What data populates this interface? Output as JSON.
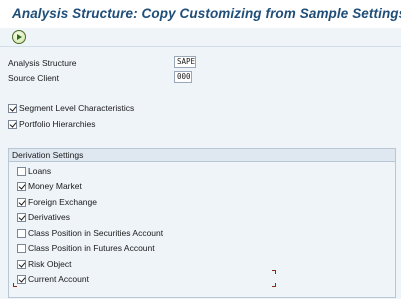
{
  "header": {
    "title": "Analysis Structure: Copy Customizing from Sample Settings"
  },
  "toolbar": {
    "execute_icon": "execute-icon"
  },
  "form": {
    "analysis_structure": {
      "label": "Analysis Structure",
      "value": "SAPE"
    },
    "source_client": {
      "label": "Source Client",
      "value": "000"
    },
    "options": [
      {
        "label": "Segment Level Characteristics",
        "checked": true
      },
      {
        "label": "Portfolio Hierarchies",
        "checked": true
      }
    ]
  },
  "derivation": {
    "title": "Derivation Settings",
    "items": [
      {
        "label": "Loans",
        "checked": false
      },
      {
        "label": "Money Market",
        "checked": true
      },
      {
        "label": "Foreign Exchange",
        "checked": true
      },
      {
        "label": "Derivatives",
        "checked": true
      },
      {
        "label": "Class Position in Securities Account",
        "checked": false
      },
      {
        "label": "Class Position in Futures Account",
        "checked": false
      },
      {
        "label": "Risk Object",
        "checked": true
      },
      {
        "label": "Current Account",
        "checked": true
      }
    ]
  },
  "colors": {
    "title": "#1f4e79",
    "background": "#eff4f9",
    "group_header": "#dfe8f1",
    "focus_marker": "#8b2c12"
  }
}
